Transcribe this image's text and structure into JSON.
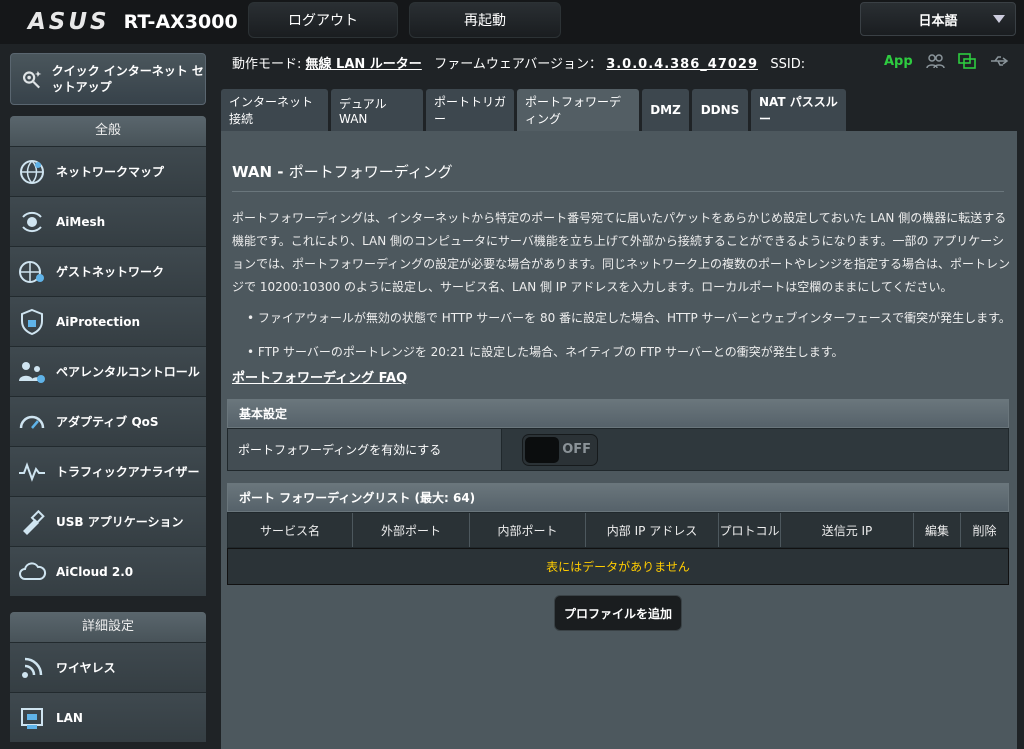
{
  "header": {
    "logo": "ASUS",
    "model": "RT-AX3000",
    "logout": "ログアウト",
    "reboot": "再起動",
    "language": "日本語"
  },
  "status": {
    "mode_label": "動作モード:",
    "mode_value": "無線 LAN ルーター",
    "fw_label": "ファームウェアバージョン：",
    "fw_value": "3.0.0.4.386_47029",
    "ssid_label": "SSID:",
    "app": "App"
  },
  "sidebar": {
    "quick": "クイック インターネット セットアップ",
    "general_header": "全般",
    "general": [
      {
        "label": "ネットワークマップ",
        "icon": "network-map-icon"
      },
      {
        "label": "AiMesh",
        "icon": "aimesh-icon"
      },
      {
        "label": "ゲストネットワーク",
        "icon": "guest-network-icon"
      },
      {
        "label": "AiProtection",
        "icon": "shield-icon"
      },
      {
        "label": "ペアレンタルコントロール",
        "icon": "parental-control-icon"
      },
      {
        "label": "アダプティブ QoS",
        "icon": "gauge-icon"
      },
      {
        "label": "トラフィックアナライザー",
        "icon": "traffic-icon"
      },
      {
        "label": "USB アプリケーション",
        "icon": "usb-icon"
      },
      {
        "label": "AiCloud 2.0",
        "icon": "cloud-icon"
      }
    ],
    "advanced_header": "詳細設定",
    "advanced": [
      {
        "label": "ワイヤレス",
        "icon": "wireless-icon"
      },
      {
        "label": "LAN",
        "icon": "lan-icon"
      }
    ]
  },
  "tabs": [
    "インターネット接続",
    "デュアル WAN",
    "ポートトリガー",
    "ポートフォワーディング",
    "DMZ",
    "DDNS",
    "NAT パススルー"
  ],
  "panel": {
    "title_prefix": "WAN - ",
    "title": "ポートフォワーディング",
    "desc": "ポートフォワーディングは、インターネットから特定のポート番号宛てに届いたパケットをあらかじめ設定しておいた LAN 側の機器に転送する機能です。これにより、LAN 側のコンピュータにサーバ機能を立ち上げて外部から接続することができるようになります。一部の アプリケーションでは、ポートフォワーディングの設定が必要な場合があります。同じネットワーク上の複数のポートやレンジを指定する場合は、ポートレンジで 10200:10300 のように設定し、サービス名、LAN 側 IP アドレスを入力します。ローカルポートは空欄のままにしてください。",
    "bullet1": "ファイアウォールが無効の状態で HTTP サーバーを 80 番に設定した場合、HTTP サーバーとウェブインターフェースで衝突が発生します。",
    "bullet2": "FTP サーバーのポートレンジを 20:21 に設定した場合、ネイティブの FTP サーバーとの衝突が発生します。",
    "faq": "ポートフォワーディング FAQ",
    "basic_header": "基本設定",
    "enable_label": "ポートフォワーディングを有効にする",
    "toggle": "OFF",
    "list_header": "ポート フォワーディングリスト (最大: 64)",
    "columns": [
      "サービス名",
      "外部ポート",
      "内部ポート",
      "内部 IP アドレス",
      "プロトコル",
      "送信元 IP",
      "編集",
      "削除"
    ],
    "empty": "表にはデータがありません",
    "add": "プロファイルを追加"
  }
}
